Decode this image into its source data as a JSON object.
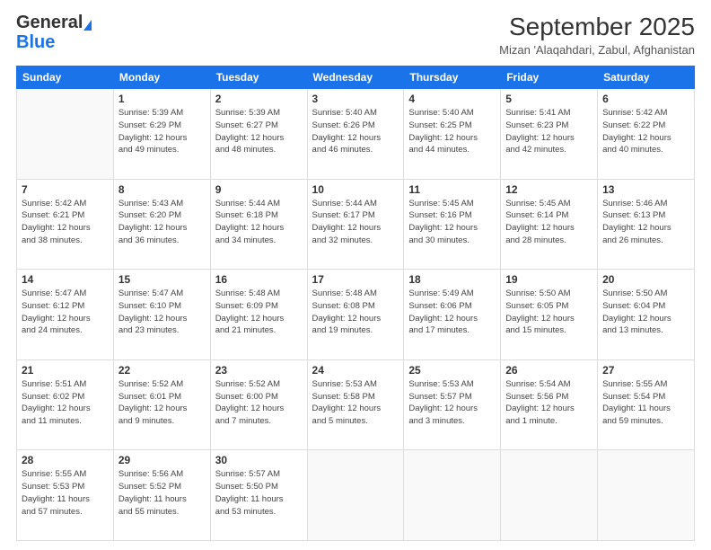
{
  "header": {
    "logo_line1_gen": "General",
    "logo_line2_blue": "Blue",
    "month": "September 2025",
    "location": "Mizan 'Alaqahdari, Zabul, Afghanistan"
  },
  "days_of_week": [
    "Sunday",
    "Monday",
    "Tuesday",
    "Wednesday",
    "Thursday",
    "Friday",
    "Saturday"
  ],
  "weeks": [
    [
      {
        "num": "",
        "info": ""
      },
      {
        "num": "1",
        "info": "Sunrise: 5:39 AM\nSunset: 6:29 PM\nDaylight: 12 hours\nand 49 minutes."
      },
      {
        "num": "2",
        "info": "Sunrise: 5:39 AM\nSunset: 6:27 PM\nDaylight: 12 hours\nand 48 minutes."
      },
      {
        "num": "3",
        "info": "Sunrise: 5:40 AM\nSunset: 6:26 PM\nDaylight: 12 hours\nand 46 minutes."
      },
      {
        "num": "4",
        "info": "Sunrise: 5:40 AM\nSunset: 6:25 PM\nDaylight: 12 hours\nand 44 minutes."
      },
      {
        "num": "5",
        "info": "Sunrise: 5:41 AM\nSunset: 6:23 PM\nDaylight: 12 hours\nand 42 minutes."
      },
      {
        "num": "6",
        "info": "Sunrise: 5:42 AM\nSunset: 6:22 PM\nDaylight: 12 hours\nand 40 minutes."
      }
    ],
    [
      {
        "num": "7",
        "info": "Sunrise: 5:42 AM\nSunset: 6:21 PM\nDaylight: 12 hours\nand 38 minutes."
      },
      {
        "num": "8",
        "info": "Sunrise: 5:43 AM\nSunset: 6:20 PM\nDaylight: 12 hours\nand 36 minutes."
      },
      {
        "num": "9",
        "info": "Sunrise: 5:44 AM\nSunset: 6:18 PM\nDaylight: 12 hours\nand 34 minutes."
      },
      {
        "num": "10",
        "info": "Sunrise: 5:44 AM\nSunset: 6:17 PM\nDaylight: 12 hours\nand 32 minutes."
      },
      {
        "num": "11",
        "info": "Sunrise: 5:45 AM\nSunset: 6:16 PM\nDaylight: 12 hours\nand 30 minutes."
      },
      {
        "num": "12",
        "info": "Sunrise: 5:45 AM\nSunset: 6:14 PM\nDaylight: 12 hours\nand 28 minutes."
      },
      {
        "num": "13",
        "info": "Sunrise: 5:46 AM\nSunset: 6:13 PM\nDaylight: 12 hours\nand 26 minutes."
      }
    ],
    [
      {
        "num": "14",
        "info": "Sunrise: 5:47 AM\nSunset: 6:12 PM\nDaylight: 12 hours\nand 24 minutes."
      },
      {
        "num": "15",
        "info": "Sunrise: 5:47 AM\nSunset: 6:10 PM\nDaylight: 12 hours\nand 23 minutes."
      },
      {
        "num": "16",
        "info": "Sunrise: 5:48 AM\nSunset: 6:09 PM\nDaylight: 12 hours\nand 21 minutes."
      },
      {
        "num": "17",
        "info": "Sunrise: 5:48 AM\nSunset: 6:08 PM\nDaylight: 12 hours\nand 19 minutes."
      },
      {
        "num": "18",
        "info": "Sunrise: 5:49 AM\nSunset: 6:06 PM\nDaylight: 12 hours\nand 17 minutes."
      },
      {
        "num": "19",
        "info": "Sunrise: 5:50 AM\nSunset: 6:05 PM\nDaylight: 12 hours\nand 15 minutes."
      },
      {
        "num": "20",
        "info": "Sunrise: 5:50 AM\nSunset: 6:04 PM\nDaylight: 12 hours\nand 13 minutes."
      }
    ],
    [
      {
        "num": "21",
        "info": "Sunrise: 5:51 AM\nSunset: 6:02 PM\nDaylight: 12 hours\nand 11 minutes."
      },
      {
        "num": "22",
        "info": "Sunrise: 5:52 AM\nSunset: 6:01 PM\nDaylight: 12 hours\nand 9 minutes."
      },
      {
        "num": "23",
        "info": "Sunrise: 5:52 AM\nSunset: 6:00 PM\nDaylight: 12 hours\nand 7 minutes."
      },
      {
        "num": "24",
        "info": "Sunrise: 5:53 AM\nSunset: 5:58 PM\nDaylight: 12 hours\nand 5 minutes."
      },
      {
        "num": "25",
        "info": "Sunrise: 5:53 AM\nSunset: 5:57 PM\nDaylight: 12 hours\nand 3 minutes."
      },
      {
        "num": "26",
        "info": "Sunrise: 5:54 AM\nSunset: 5:56 PM\nDaylight: 12 hours\nand 1 minute."
      },
      {
        "num": "27",
        "info": "Sunrise: 5:55 AM\nSunset: 5:54 PM\nDaylight: 11 hours\nand 59 minutes."
      }
    ],
    [
      {
        "num": "28",
        "info": "Sunrise: 5:55 AM\nSunset: 5:53 PM\nDaylight: 11 hours\nand 57 minutes."
      },
      {
        "num": "29",
        "info": "Sunrise: 5:56 AM\nSunset: 5:52 PM\nDaylight: 11 hours\nand 55 minutes."
      },
      {
        "num": "30",
        "info": "Sunrise: 5:57 AM\nSunset: 5:50 PM\nDaylight: 11 hours\nand 53 minutes."
      },
      {
        "num": "",
        "info": ""
      },
      {
        "num": "",
        "info": ""
      },
      {
        "num": "",
        "info": ""
      },
      {
        "num": "",
        "info": ""
      }
    ]
  ]
}
